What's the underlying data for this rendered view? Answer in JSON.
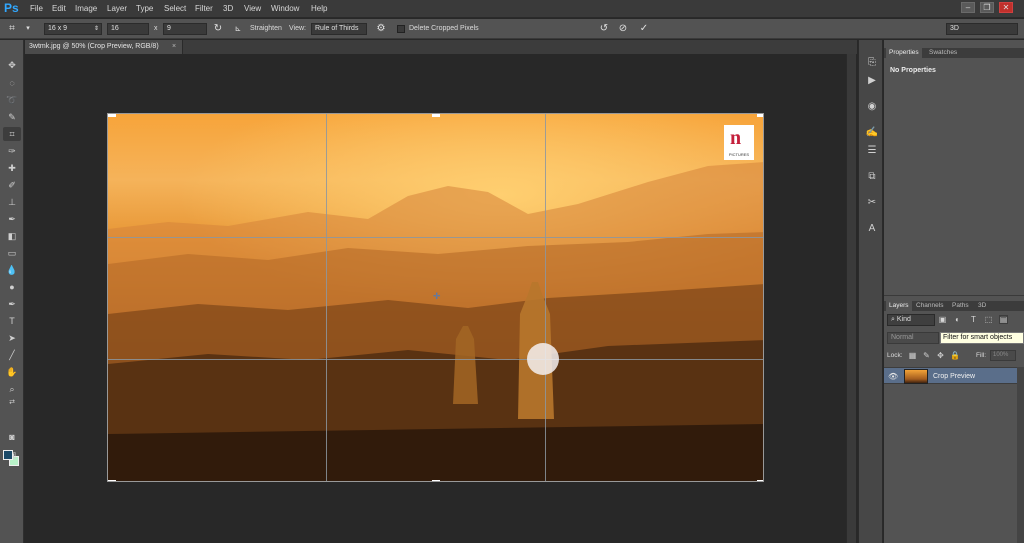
{
  "app": {
    "logo": "Ps"
  },
  "menu": [
    "File",
    "Edit",
    "Image",
    "Layer",
    "Type",
    "Select",
    "Filter",
    "3D",
    "View",
    "Window",
    "Help"
  ],
  "window_controls": {
    "minimize": "–",
    "restore": "❐",
    "close": "✕"
  },
  "options": {
    "ratio": "16 x 9",
    "width": "16",
    "x_label": "x",
    "height": "9",
    "straighten_label": "Straighten",
    "view_label": "View:",
    "view_value": "Rule of Thirds",
    "delete_cropped": "Delete Cropped Pixels",
    "workspace": "3D"
  },
  "document": {
    "tab_title": "3wtmk.jpg @ 50% (Crop Preview, RGB/8)",
    "close": "×",
    "watermark_text": "PICTURES"
  },
  "colors": {
    "foreground": "#1c4a68",
    "background": "#b8f1c8",
    "accent": "#31a8ff",
    "selected_layer": "#5a6e8a"
  },
  "properties_panel": {
    "tabs": [
      "Properties",
      "Swatches"
    ],
    "content": "No Properties"
  },
  "layers_panel": {
    "tabs": [
      "Layers",
      "Channels",
      "Paths",
      "3D"
    ],
    "kind": "Kind",
    "blend_mode": "Normal",
    "tooltip": "Filter for smart objects",
    "lock_label": "Lock:",
    "fill_label": "Fill:",
    "fill_value": "100%",
    "layers": [
      {
        "name": "Crop Preview",
        "visible": true
      }
    ]
  }
}
